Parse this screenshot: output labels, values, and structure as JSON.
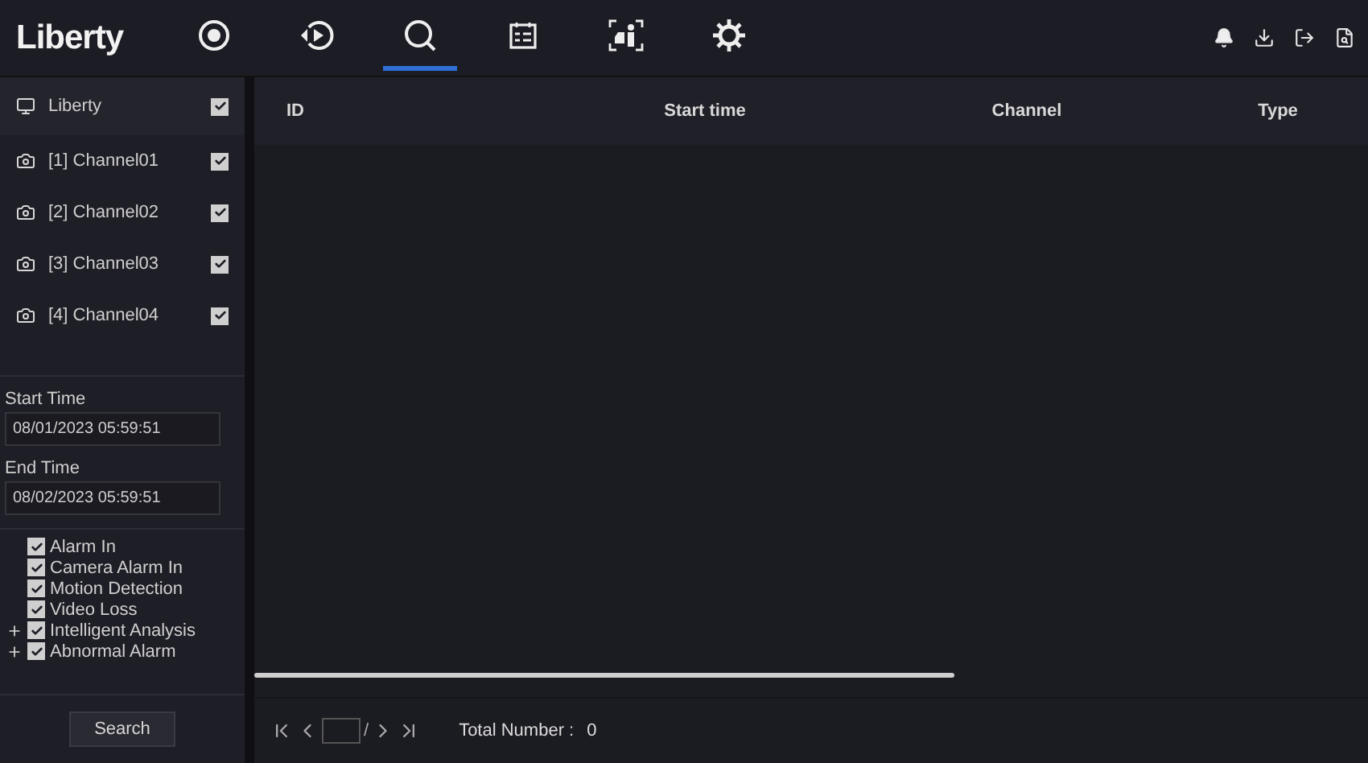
{
  "brand": "Liberty",
  "nav": [
    {
      "kind": "target",
      "selected": false
    },
    {
      "kind": "playback",
      "selected": false
    },
    {
      "kind": "search",
      "selected": true
    },
    {
      "kind": "calendar",
      "selected": false
    },
    {
      "kind": "person",
      "selected": false
    },
    {
      "kind": "gear",
      "selected": false
    }
  ],
  "toolbar": [
    {
      "kind": "bell"
    },
    {
      "kind": "download"
    },
    {
      "kind": "logout"
    },
    {
      "kind": "file"
    }
  ],
  "device": {
    "name": "Liberty",
    "checked": true
  },
  "channels": [
    {
      "name": "[1] Channel01",
      "checked": true
    },
    {
      "name": "[2] Channel02",
      "checked": true
    },
    {
      "name": "[3] Channel03",
      "checked": true
    },
    {
      "name": "[4] Channel04",
      "checked": true
    }
  ],
  "start_time": {
    "label": "Start Time",
    "value": "08/01/2023 05:59:51"
  },
  "end_time": {
    "label": "End Time",
    "value": "08/02/2023 05:59:51"
  },
  "event_types": [
    {
      "label": "Alarm In",
      "kind": "leaf",
      "checked": true
    },
    {
      "label": "Camera Alarm In",
      "kind": "leaf",
      "checked": true
    },
    {
      "label": "Motion Detection",
      "kind": "leaf",
      "checked": true
    },
    {
      "label": "Video Loss",
      "kind": "leaf",
      "checked": true
    },
    {
      "label": "Intelligent Analysis",
      "kind": "group",
      "expanded": false,
      "checked": true
    },
    {
      "label": "Abnormal Alarm",
      "kind": "group",
      "expanded": false,
      "checked": true
    }
  ],
  "search_button": "Search",
  "table": {
    "columns": [
      "ID",
      "Start time",
      "Channel",
      "Type"
    ]
  },
  "pagination": {
    "separator": "/",
    "total_label": "Total Number :",
    "total": "0"
  }
}
